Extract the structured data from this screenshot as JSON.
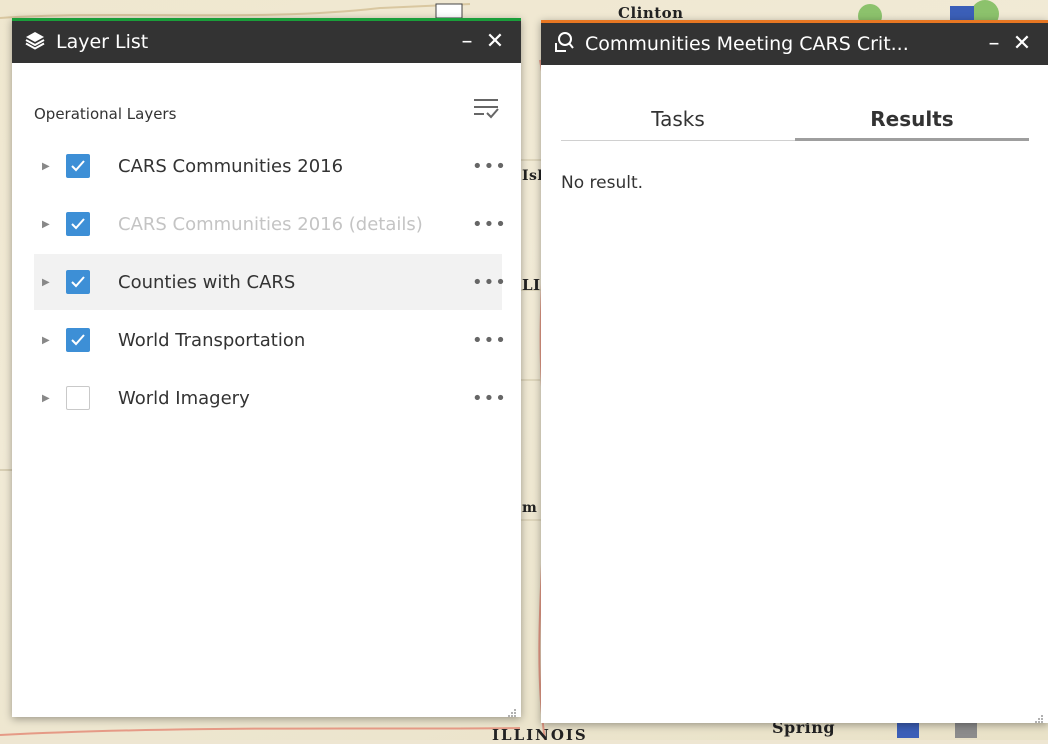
{
  "map": {
    "labels": [
      "Clinton",
      "Isl",
      "LI",
      "m",
      "Spring",
      "ILLINOIS"
    ]
  },
  "layer_list": {
    "title": "Layer List",
    "minimize": "–",
    "close": "✕",
    "section": "Operational Layers",
    "more": "•••",
    "layers": [
      {
        "label": "CARS Communities 2016",
        "checked": true
      },
      {
        "label": "CARS Communities 2016 (details)",
        "checked": true
      },
      {
        "label": "Counties with CARS",
        "checked": true
      },
      {
        "label": "World Transportation",
        "checked": true
      },
      {
        "label": "World Imagery",
        "checked": false
      }
    ],
    "accent": "#1a9e3a"
  },
  "query": {
    "title": "Communities Meeting CARS Crit...",
    "minimize": "–",
    "close": "✕",
    "tabs": [
      "Tasks",
      "Results"
    ],
    "active_tab": "Results",
    "result_text": "No result.",
    "accent": "#e87722"
  },
  "colors": {
    "header_bg": "#333333",
    "checkbox": "#3d8fd6"
  }
}
